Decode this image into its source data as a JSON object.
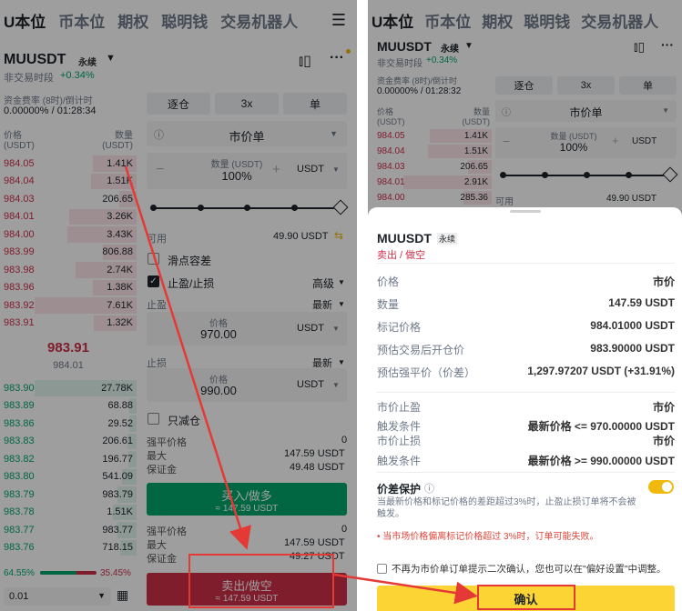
{
  "nav": {
    "tabs": [
      "U本位",
      "币本位",
      "期权",
      "聪明钱",
      "交易机器人"
    ]
  },
  "ticker": {
    "symbol": "MUUSDT",
    "type": "永续",
    "session": "非交易时段",
    "change": "+0.34%"
  },
  "funding": {
    "label": "资金费率 (8时)/倒计时",
    "value": "0.00000% / 01:28:34",
    "value_right": "0.00000% / 01:28:32"
  },
  "orderbook": {
    "price_header": "价格\n(USDT)",
    "qty_header": "数量\n(USDT)",
    "asks": [
      [
        "984.05",
        "1.41K"
      ],
      [
        "984.04",
        "1.51K"
      ],
      [
        "984.03",
        "206.65"
      ],
      [
        "984.01",
        "3.26K"
      ],
      [
        "984.00",
        "3.43K"
      ],
      [
        "983.99",
        "806.88"
      ],
      [
        "983.98",
        "2.74K"
      ],
      [
        "983.96",
        "1.38K"
      ],
      [
        "983.92",
        "7.61K"
      ],
      [
        "983.91",
        "1.32K"
      ]
    ],
    "asks_right": [
      [
        "984.05",
        "1.41K"
      ],
      [
        "984.04",
        "1.51K"
      ],
      [
        "984.03",
        "206.65"
      ],
      [
        "984.01",
        "2.91K"
      ],
      [
        "984.00",
        "285.36"
      ]
    ],
    "last": "983.91",
    "mark": "984.01",
    "bids": [
      [
        "983.90",
        "27.78K"
      ],
      [
        "983.89",
        "68.88"
      ],
      [
        "983.86",
        "29.52"
      ],
      [
        "983.83",
        "206.61"
      ],
      [
        "983.82",
        "196.77"
      ],
      [
        "983.80",
        "541.09"
      ],
      [
        "983.79",
        "983.79"
      ],
      [
        "983.78",
        "1.51K"
      ],
      [
        "983.77",
        "983.77"
      ],
      [
        "983.76",
        "718.15"
      ]
    ],
    "buy_ratio": "64.55%",
    "sell_ratio": "35.45%",
    "buy_ratio_value": 0.6455,
    "precision": "0.01"
  },
  "form": {
    "margin_mode": "逐仓",
    "leverage": "3x",
    "position_mode": "单",
    "order_type": "市价单",
    "qty_label": "数量 (USDT)",
    "qty_value": "100%",
    "unit": "USDT",
    "available_label": "可用",
    "available_value": "49.90 USDT",
    "slippage": "滑点容差",
    "tpsl": "止盈/止损",
    "advanced": "高级",
    "tp_label": "止盈",
    "tp_trigger": "最新",
    "tp_price_label": "价格",
    "tp_price": "970.00",
    "sl_label": "止损",
    "sl_trigger": "最新",
    "sl_price_label": "价格",
    "sl_price": "990.00",
    "reduce_only": "只减仓",
    "liq_label": "强平价格",
    "liq_value": "0",
    "max_label": "最大",
    "max_value": "147.59 USDT",
    "margin_label": "保证金",
    "margin_value_buy": "49.48 USDT",
    "margin_value_sell": "49.27 USDT",
    "buy_label": "买入/做多",
    "buy_sub": "≈ 147.59 USDT",
    "sell_label": "卖出/做空",
    "sell_sub": "≈ 147.59 USDT",
    "slider_fraction": 1.0
  },
  "sheet": {
    "symbol": "MUUSDT",
    "type": "永续",
    "side": "卖出 / 做空",
    "rows": [
      [
        "价格",
        "市价"
      ],
      [
        "数量",
        "147.59 USDT"
      ],
      [
        "标记价格",
        "984.01000 USDT"
      ],
      [
        "预估交易后开仓价",
        "983.90000 USDT"
      ],
      [
        "预估强平价（价差）",
        "1,297.97207 USDT (+31.91%)"
      ]
    ],
    "tp_label": "市价止盈",
    "tp_value": "市价",
    "tp_cond_label": "触发条件",
    "tp_cond": "最新价格 <= 970.00000 USDT",
    "sl_label": "市价止损",
    "sl_value": "市价",
    "sl_cond_label": "触发条件",
    "sl_cond": "最新价格 >= 990.00000 USDT",
    "protect_title": "价差保护",
    "protect_desc": "当最新价格和标记价格的差距超过3%时，止盈止损订单将不会被触发。",
    "warning": "• 当市场价格偏离标记价格超过 3%时，订单可能失败。",
    "no_confirm": "不再为市价单订单提示二次确认，您也可以在\"偏好设置\"中调整。",
    "confirm": "确认"
  },
  "colors": {
    "red": "#cf304a",
    "green": "#03a66d",
    "yellow": "#fcd535",
    "accent_orange": "#f0b90b"
  }
}
